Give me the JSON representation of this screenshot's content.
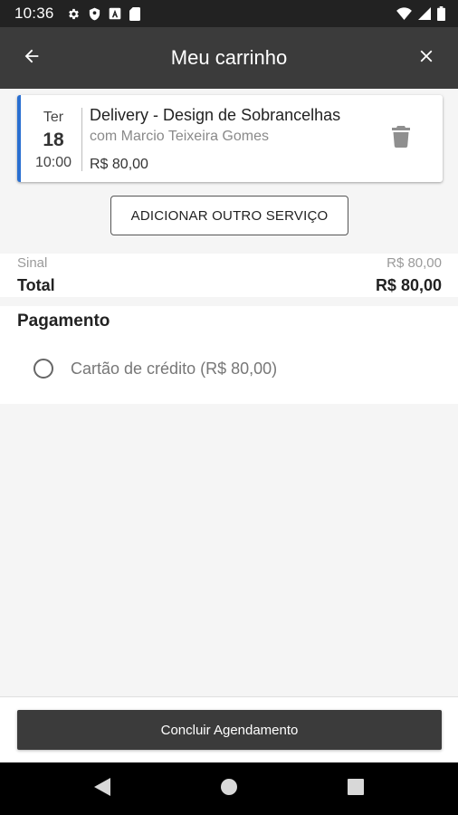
{
  "status_bar": {
    "time": "10:36",
    "left_icons": [
      "gear-icon",
      "shield-icon",
      "a-box-icon",
      "sd-card-icon"
    ],
    "right_icons": [
      "wifi-icon",
      "signal-icon",
      "battery-icon"
    ]
  },
  "app_bar": {
    "title": "Meu carrinho",
    "back_icon": "arrow-left-icon",
    "close_icon": "close-icon"
  },
  "cart_item": {
    "day_of_week": "Ter",
    "day": "18",
    "time": "10:00",
    "service": "Delivery - Design de Sobrancelhas",
    "professional": "com Marcio Teixeira Gomes",
    "price": "R$ 80,00",
    "accent_color": "#2a6fd1"
  },
  "add_service_label": "ADICIONAR OUTRO SERVIÇO",
  "summary": {
    "sinal_label": "Sinal",
    "sinal_value": "R$ 80,00",
    "total_label": "Total",
    "total_value": "R$ 80,00"
  },
  "payment": {
    "title": "Pagamento",
    "options": [
      {
        "label": "Cartão de crédito (R$ 80,00)",
        "selected": false
      }
    ]
  },
  "conclude_label": "Concluir Agendamento",
  "nav_bar": {
    "icons": [
      "back-triangle-icon",
      "home-circle-icon",
      "recents-square-icon"
    ]
  }
}
